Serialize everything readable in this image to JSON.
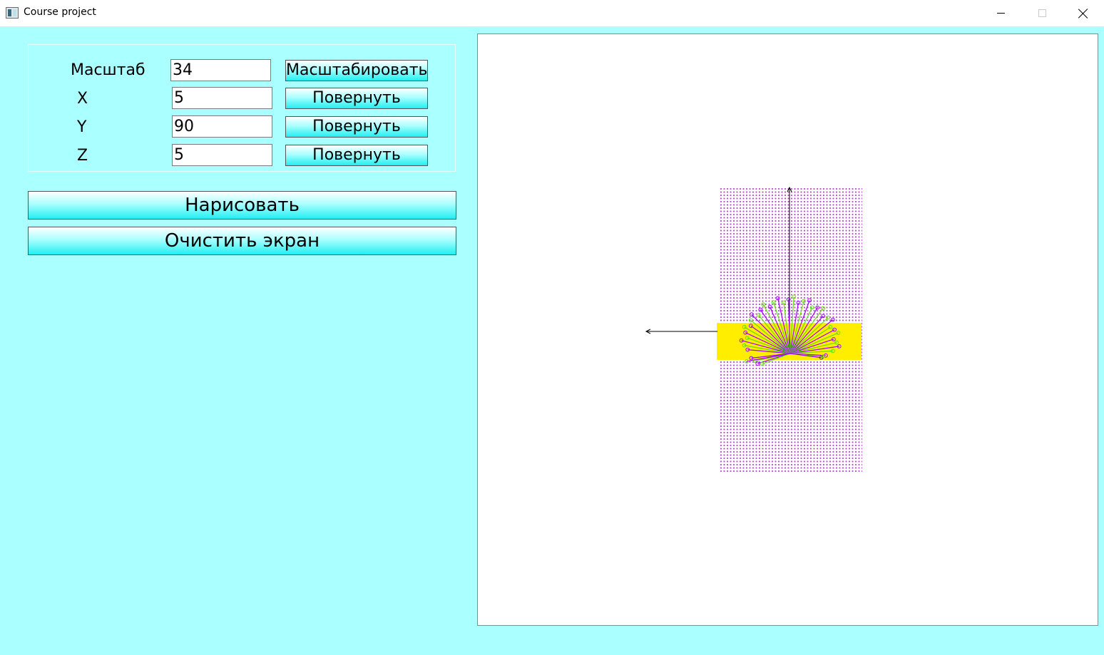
{
  "window": {
    "title": "Course project",
    "icon": "app-window-icon",
    "controls": [
      "minimize-icon",
      "maximize-icon",
      "close-icon"
    ]
  },
  "controls": {
    "scale": {
      "label": "Масштаб",
      "value": "34",
      "button": "Масштабировать"
    },
    "x": {
      "label": "X",
      "value": "5",
      "button": "Повернуть"
    },
    "y": {
      "label": "Y",
      "value": "90",
      "button": "Повернуть"
    },
    "z": {
      "label": "Z",
      "value": "5",
      "button": "Повернуть"
    }
  },
  "actions": {
    "draw": "Нарисовать",
    "clear": "Очистить экран"
  },
  "canvas": {
    "colors": {
      "background": "#ffffff",
      "grid_dots": "#b84fd0",
      "band": "#ffee00",
      "axes": "#000000",
      "ray_a": "#a000ff",
      "ray_b": "#66dd11"
    }
  }
}
